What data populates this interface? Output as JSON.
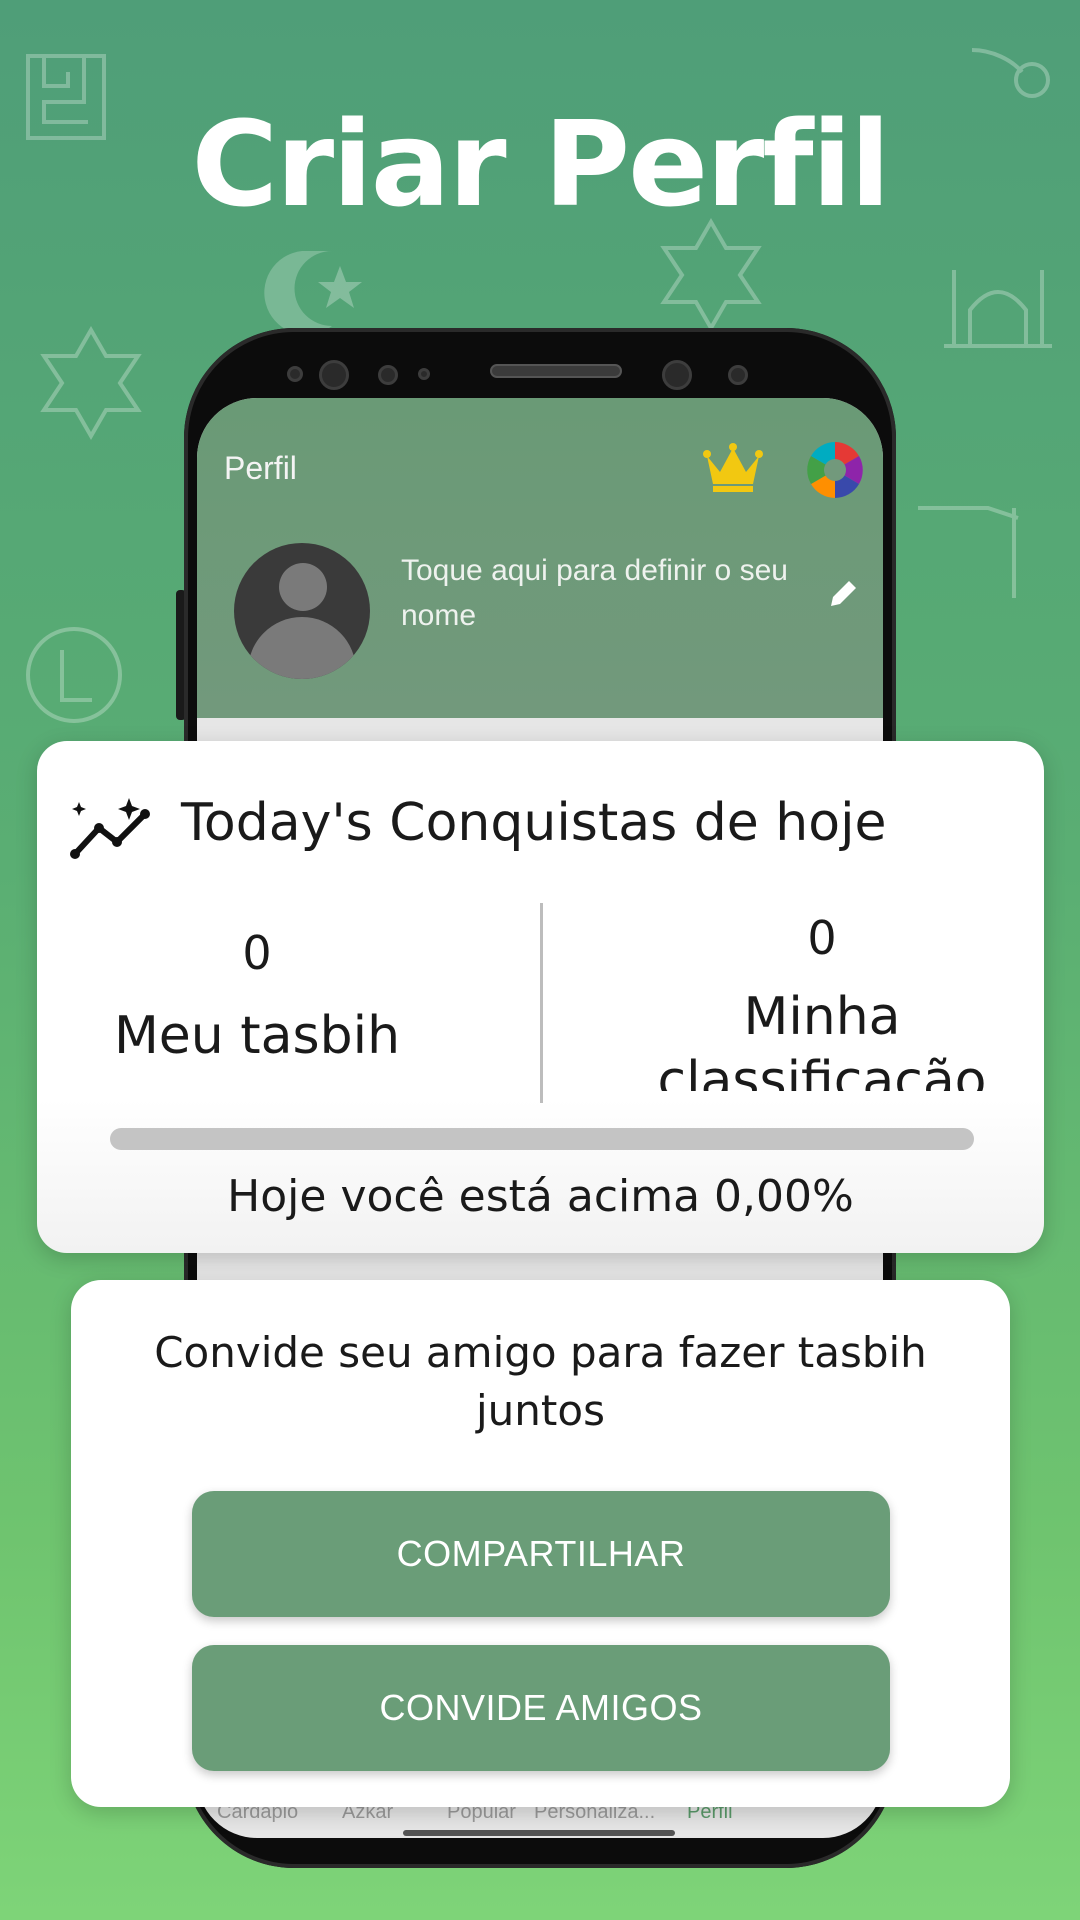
{
  "headline": "Criar Perfil",
  "app": {
    "title": "Perfil",
    "name_hint": "Toque aqui para definir o seu nome",
    "icons": {
      "premium": "crown-icon",
      "theme": "color-wheel-icon",
      "edit": "pencil-icon"
    }
  },
  "achievements": {
    "title": "Today's Conquistas de hoje",
    "my_tasbih": {
      "value": "0",
      "label": "Meu tasbih"
    },
    "my_rank": {
      "value": "0",
      "label": "Minha classificação"
    },
    "progress_percent": 0,
    "above_text": "Hoje você está acima 0,00%"
  },
  "invite": {
    "text": "Convide seu amigo para fazer tasbih juntos",
    "share_label": "COMPARTILHAR",
    "invite_label": "CONVIDE AMIGOS"
  },
  "nav": {
    "items": [
      {
        "label": "Cardápio"
      },
      {
        "label": "Azkar"
      },
      {
        "label": "Popular"
      },
      {
        "label": "Personaliza..."
      },
      {
        "label": "Perfil"
      }
    ],
    "active": "Perfil"
  },
  "colors": {
    "accent": "#6a9d78",
    "crown": "#f2c811",
    "header": "#6a9a76"
  }
}
